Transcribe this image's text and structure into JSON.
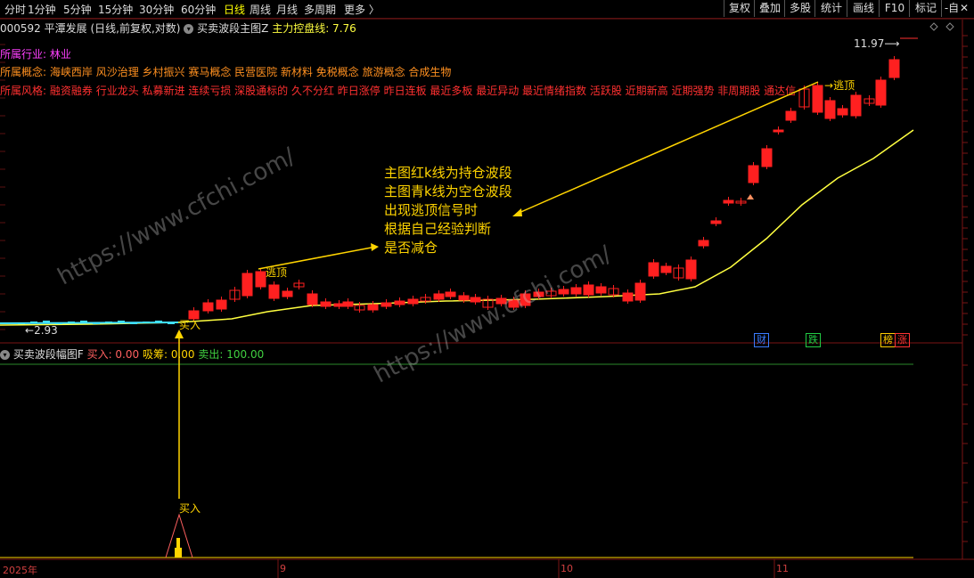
{
  "toolbar": {
    "periods": [
      "分时",
      "1分钟",
      "5分钟",
      "15分钟",
      "30分钟",
      "60分钟",
      "日线",
      "周线",
      "月线",
      "多周期",
      "更多 〉"
    ],
    "active_period": "日线",
    "right_buttons": [
      "复权",
      "叠加",
      "多股",
      "统计",
      "画线",
      "F10",
      "标记",
      "-自选"
    ],
    "close": "✕"
  },
  "header": {
    "stock_code": "000592",
    "stock_name": "平潭发展",
    "chart_mode": "(日线,前复权,对数)",
    "indicator_name": "买卖波段主图Z",
    "indicator_line_label": "主力控盘线: 7.76"
  },
  "info_lines": {
    "industry_label": "所属行业:",
    "industry_value": "林业",
    "concept_label": "所属概念:",
    "concept_value": "海峡西岸 风沙治理 乡村振兴 赛马概念 民营医院 新材料 免税概念 旅游概念 合成生物",
    "style_label": "所属风格:",
    "style_value": "融资融券 行业龙头 私募新进 连续亏损 深股通标的 久不分红 昨日涨停 昨日连板 最近多板 最近异动 最近情绪指数 活跃股 近期新高 近期强势 非周期股 通达信"
  },
  "main_chart": {
    "high_label": "11.97",
    "low_label": "2.93",
    "signal_top_1": "逃顶",
    "signal_top_2": "逃顶",
    "signal_buy": "买入",
    "annotation_lines": [
      "主图红k线为持仓波段",
      "主图青k线为空仓波段",
      "出现逃顶信号时",
      "根据自己经验判断",
      "是否减仓"
    ],
    "event_tags": [
      {
        "text": "财",
        "color": "#3a7bff"
      },
      {
        "text": "跌",
        "color": "#22cc44"
      },
      {
        "text": "榜",
        "color": "#ffcc00"
      },
      {
        "text": "涨",
        "color": "#ff3333"
      }
    ],
    "watermark": "https://www.cfchi.com/"
  },
  "sub_chart": {
    "title": "买卖波段幅图F",
    "buy_label": "买入: 0.00",
    "absorb_label": "吸筹: 0.00",
    "sell_label": "卖出: 100.00",
    "buy_signal": "买入"
  },
  "date_axis": {
    "labels": [
      "2025年",
      "9",
      "10",
      "11"
    ]
  },
  "colors": {
    "up": "#ff2020",
    "down_cyan": "#40e0ff",
    "ma_line": "#ffff40",
    "annotation": "#ffd400",
    "grid_red": "#7a1414"
  }
}
